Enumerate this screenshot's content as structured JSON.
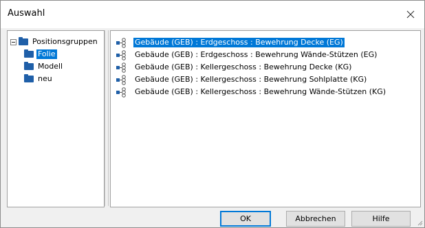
{
  "window": {
    "title": "Auswahl"
  },
  "tree": {
    "root": {
      "label": "Positionsgruppen",
      "expanded": true
    },
    "children": [
      {
        "label": "Folie",
        "selected": true
      },
      {
        "label": "Modell",
        "selected": false
      },
      {
        "label": "neu",
        "selected": false
      }
    ]
  },
  "list": {
    "items": [
      {
        "label": "Gebäude (GEB) : Erdgeschoss : Bewehrung Decke (EG)",
        "selected": true
      },
      {
        "label": "Gebäude (GEB) : Erdgeschoss : Bewehrung Wände-Stützen (EG)",
        "selected": false
      },
      {
        "label": "Gebäude (GEB) : Kellergeschoss : Bewehrung Decke (KG)",
        "selected": false
      },
      {
        "label": "Gebäude (GEB) : Kellergeschoss : Bewehrung Sohlplatte (KG)",
        "selected": false
      },
      {
        "label": "Gebäude (GEB) : Kellergeschoss : Bewehrung Wände-Stützen (KG)",
        "selected": false
      }
    ]
  },
  "buttons": {
    "ok": "OK",
    "cancel": "Abbrechen",
    "help": "Hilfe"
  },
  "colors": {
    "selection": "#0078d7",
    "folder": "#1f5fa8",
    "rebar_icon": "#1f5fa8"
  },
  "icons": {
    "close": "close-icon",
    "tree_expander": "collapse-minus-icon",
    "folder": "folder-icon",
    "item": "rebar-group-icon"
  }
}
